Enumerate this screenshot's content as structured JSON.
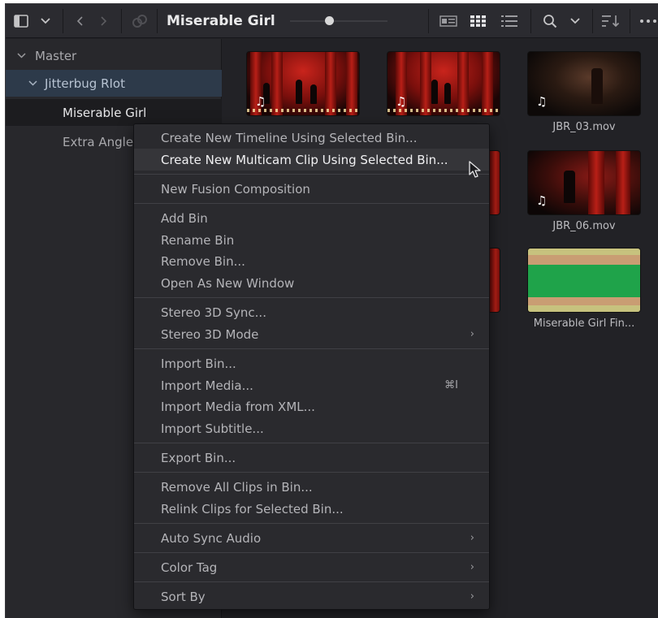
{
  "toolbar": {
    "title": "Miserable Girl",
    "icons": [
      "sidebar-toggle-icon",
      "chevron-down-icon",
      "back-icon",
      "forward-icon",
      "link-icon",
      "metadata-view-icon",
      "thumbnail-view-icon",
      "list-view-icon",
      "search-icon",
      "chevron-down-icon",
      "sort-icon",
      "more-icon"
    ],
    "zoom_slider_fraction": 0.45
  },
  "sidebar": {
    "items": [
      {
        "label": "Master",
        "expanded": true
      },
      {
        "label": "Jitterbug RIot",
        "expanded": true
      },
      {
        "label": "Miserable Girl",
        "selected": true
      },
      {
        "label": "Extra Angle"
      }
    ]
  },
  "clips": [
    {
      "label": "",
      "has_audio": true
    },
    {
      "label": "",
      "has_audio": true
    },
    {
      "label": "JBR_03.mov",
      "has_audio": true
    },
    {
      "label": "JBR_06.mov",
      "has_audio": true
    },
    {
      "label": "Miserable Girl Fin..."
    }
  ],
  "menu": {
    "items": [
      {
        "label": "Create New Timeline Using Selected Bin..."
      },
      {
        "label": "Create New Multicam Clip Using Selected Bin...",
        "highlighted": true
      },
      {
        "label": "New Fusion Composition"
      },
      {
        "label": "Add Bin"
      },
      {
        "label": "Rename Bin"
      },
      {
        "label": "Remove Bin..."
      },
      {
        "label": "Open As New Window"
      },
      {
        "label": "Stereo 3D Sync..."
      },
      {
        "label": "Stereo 3D Mode",
        "submenu": true
      },
      {
        "label": "Import Bin..."
      },
      {
        "label": "Import Media...",
        "shortcut": "⌘I"
      },
      {
        "label": "Import Media from XML..."
      },
      {
        "label": "Import Subtitle..."
      },
      {
        "label": "Export Bin..."
      },
      {
        "label": "Remove All Clips in Bin..."
      },
      {
        "label": "Relink Clips for Selected Bin..."
      },
      {
        "label": "Auto Sync Audio",
        "submenu": true
      },
      {
        "label": "Color Tag",
        "submenu": true
      },
      {
        "label": "Sort By",
        "submenu": true
      }
    ],
    "submenu_arrow": "›",
    "audio_glyph": "♫",
    "accent_color": "#2d3a4a"
  }
}
